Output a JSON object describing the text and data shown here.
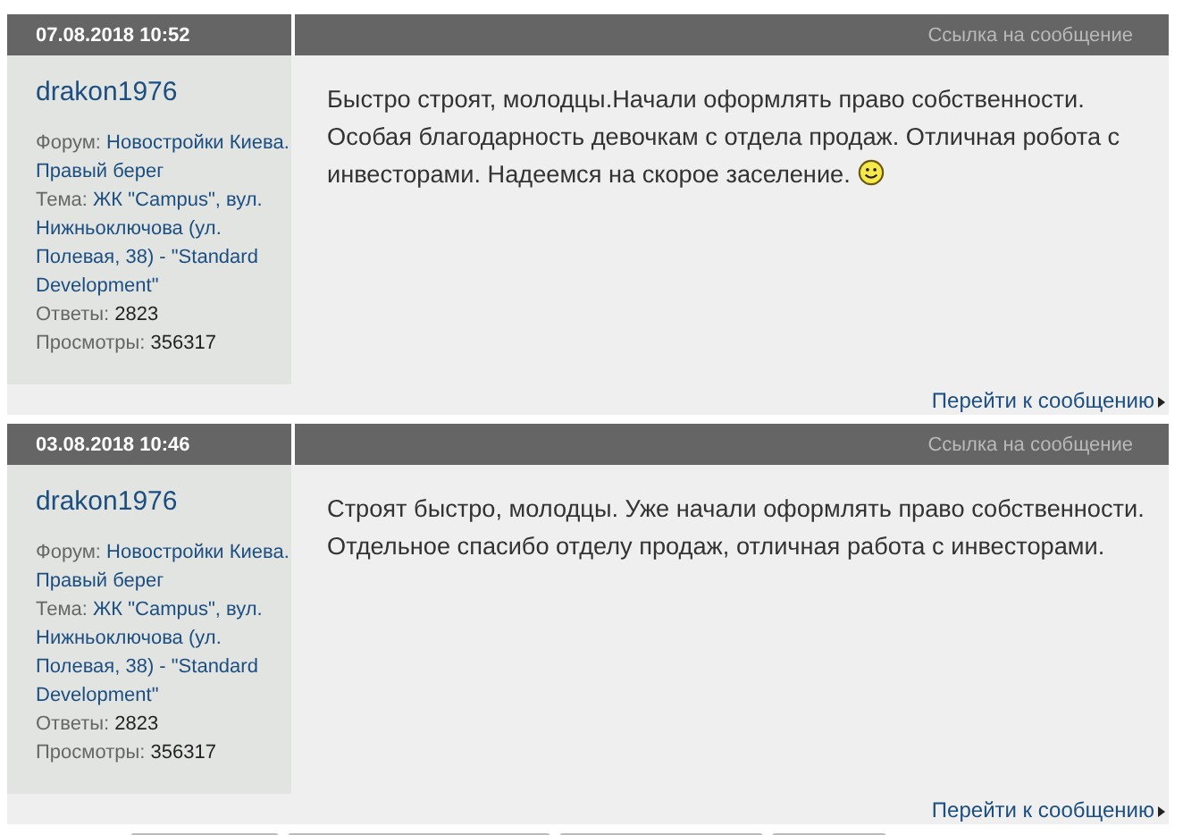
{
  "posts": [
    {
      "date": "07.08.2018 10:52",
      "link_label": "Ссылка на сообщение",
      "author": "drakon1976",
      "forum_label": "Форум:",
      "forum": "Новостройки Киева. Правый берег",
      "topic_label": "Тема:",
      "topic": "ЖК \"Campus\", вул. Нижньоключова (ул. Полевая, 38) - \"Standard Development\"",
      "replies_label": "Ответы:",
      "replies": "2823",
      "views_label": "Просмотры:",
      "views": "356317",
      "text": "Быстро строят, молодцы.Начали оформлять право собственности. Особая благодарность девочкам с отдела продаж. Отличная робота с инвесторами. Надеемся на скорое заселение.",
      "smiley": true,
      "goto": "Перейти к сообщению"
    },
    {
      "date": "03.08.2018 10:46",
      "link_label": "Ссылка на сообщение",
      "author": "drakon1976",
      "forum_label": "Форум:",
      "forum": "Новостройки Киева. Правый берег",
      "topic_label": "Тема:",
      "topic": "ЖК \"Campus\", вул. Нижньоключова (ул. Полевая, 38) - \"Standard Development\"",
      "replies_label": "Ответы:",
      "replies": "2823",
      "views_label": "Просмотры:",
      "views": "356317",
      "text": "Строят быстро, молодцы. Уже начали оформлять право собственности. Отдельное спасибо отделу продаж, отличная работа с инвесторами.",
      "smiley": false,
      "goto": "Перейти к сообщению"
    }
  ]
}
